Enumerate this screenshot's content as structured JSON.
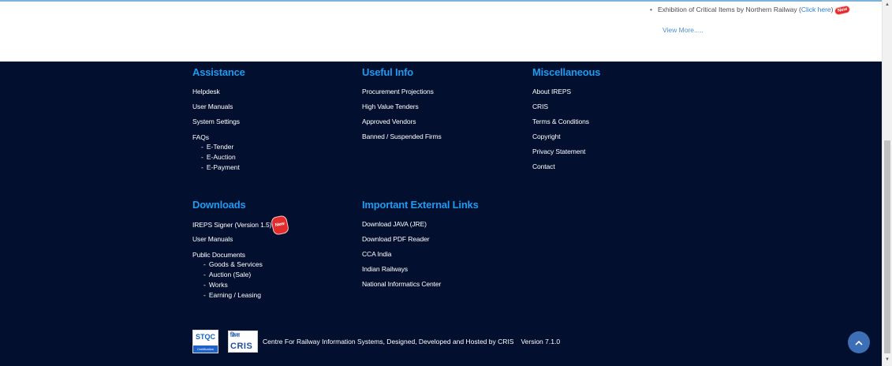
{
  "news": {
    "item_text": "Exhibition of Critical Items by Northern Railway (",
    "link": "Click here",
    "close": ")",
    "badge": "New",
    "view_more": "View More....."
  },
  "footer": {
    "assistance": {
      "title": "Assistance",
      "items": [
        "Helpdesk",
        "User Manuals",
        "System Settings",
        "FAQs"
      ],
      "faq_sub": [
        "E-Tender",
        "E-Auction",
        "E-Payment"
      ]
    },
    "useful": {
      "title": "Useful Info",
      "items": [
        "Procurement Projections",
        "High Value Tenders",
        "Approved Vendors",
        "Banned / Suspended Firms"
      ]
    },
    "misc": {
      "title": "Miscellaneous",
      "items": [
        "About IREPS",
        "CRIS",
        "Terms & Conditions",
        "Copyright",
        "Privacy Statement",
        "Contact"
      ]
    },
    "downloads": {
      "title": "Downloads",
      "items": [
        "IREPS Signer (Version 1.5)",
        "User Manuals",
        "Public Documents"
      ],
      "badge": "New",
      "public_sub": [
        "Goods & Services",
        "Auction (Sale)",
        "Works",
        "Earning / Leasing"
      ]
    },
    "external": {
      "title": "Important External Links",
      "items": [
        "Download JAVA (JRE)",
        "Download PDF Reader",
        "CCA India",
        "Indian Railways",
        "National Informatics Center"
      ]
    },
    "credits": {
      "text": "Centre For Railway Information Systems, Designed, Developed and Hosted by CRIS",
      "version": "Version 7.1.0",
      "stqc_logo": "STQC",
      "stqc_sub": "Certification",
      "cris_logo_hindi": "क्रिस",
      "cris_logo": "CRIS"
    }
  },
  "colors": {
    "footer_bg": "#020f2e",
    "heading": "#1f9bf0",
    "link": "#2a7fd6"
  }
}
